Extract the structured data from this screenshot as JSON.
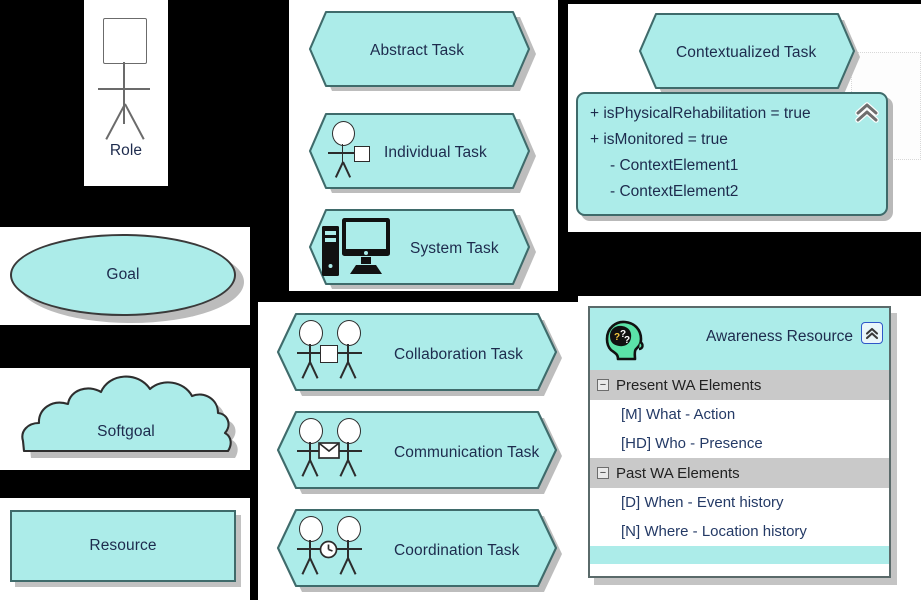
{
  "theme": {
    "fill": "#ACECE9",
    "shape_stroke": "#3f6b6b",
    "text": "#1d2b4d",
    "panel_bg": "#ffffff",
    "canvas_bg": "#000000",
    "group_header_bg": "#c9c9c9",
    "brain_green": "#5BE3A8"
  },
  "left_column": {
    "role": {
      "label": "Role",
      "icon": "actor-role-icon"
    },
    "goal": {
      "label": "Goal",
      "shape": "ellipse"
    },
    "softgoal": {
      "label": "Softgoal",
      "shape": "cloud"
    },
    "resource": {
      "label": "Resource",
      "shape": "rectangle"
    }
  },
  "middle_column": {
    "tasks_top": [
      {
        "label": "Abstract Task",
        "icon": null
      },
      {
        "label": "Individual Task",
        "icon": "single-actor-icon"
      },
      {
        "label": "System Task",
        "icon": "desktop-computer-icon"
      }
    ],
    "tasks_bottom": [
      {
        "label": "Collaboration Task",
        "icon": "two-actors-square-icon"
      },
      {
        "label": "Communication Task",
        "icon": "two-actors-envelope-icon"
      },
      {
        "label": "Coordination Task",
        "icon": "two-actors-clock-icon"
      }
    ]
  },
  "contextualized_task": {
    "title": "Contextualized Task",
    "collapse_icon": "double-chevron-up-icon",
    "attributes": [
      "+ isPhysicalRehabilitation = true",
      "+ isMonitored = true",
      "- ContextElement1",
      "- ContextElement2"
    ]
  },
  "awareness_resource": {
    "title": "Awareness Resource",
    "icon": "brain-head-icon",
    "collapse_icon": "double-chevron-up-icon",
    "groups": [
      {
        "label": "Present WA Elements",
        "toggle": "collapse-minus-icon",
        "items": [
          "[M] What - Action",
          "[HD] Who - Presence"
        ]
      },
      {
        "label": "Past WA Elements",
        "toggle": "collapse-minus-icon",
        "items": [
          "[D] When - Event history",
          "[N] Where - Location history"
        ]
      }
    ]
  }
}
